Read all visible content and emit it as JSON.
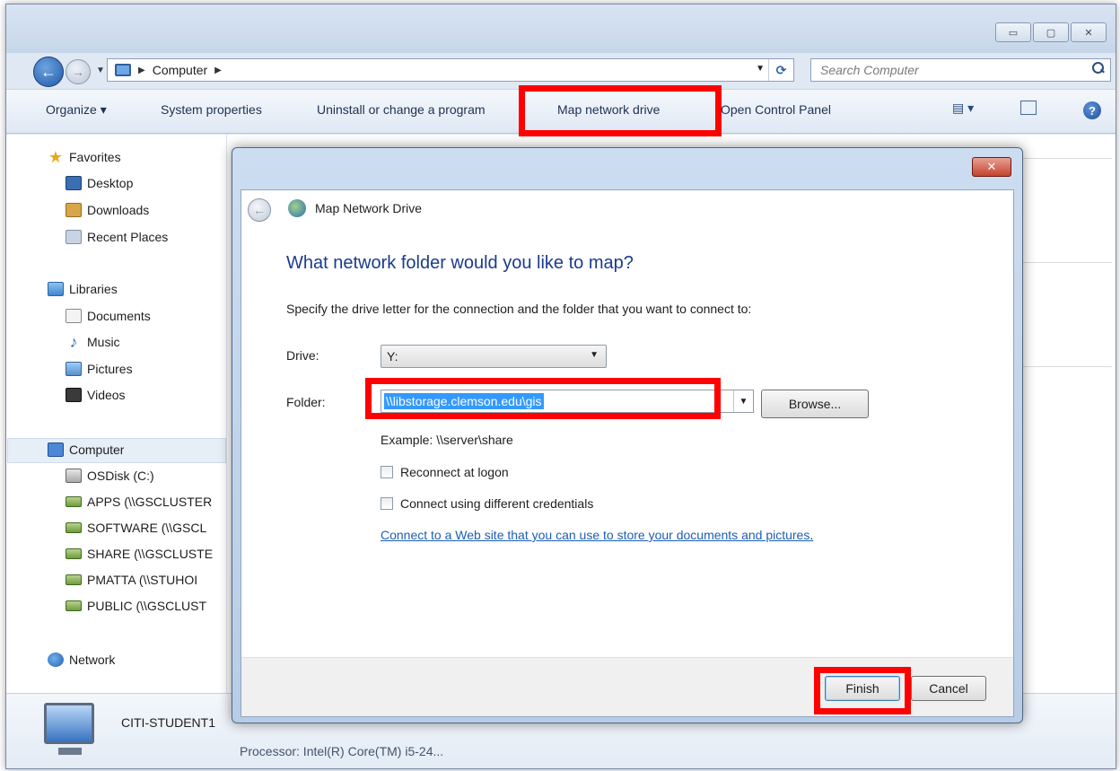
{
  "window": {
    "controls": {
      "minimize": "▭",
      "maximize": "▢",
      "close": "✕"
    },
    "address": {
      "location": "Computer",
      "chevron": "▶"
    },
    "search": {
      "placeholder": "Search Computer"
    },
    "toolbar": {
      "organize": "Organize ▾",
      "system_properties": "System properties",
      "uninstall": "Uninstall or change a program",
      "map_network_drive": "Map network drive",
      "open_control_panel": "Open Control Panel",
      "views_glyph": "▤ ▾",
      "help_glyph": "?"
    }
  },
  "navpane": {
    "favorites": {
      "title": "Favorites",
      "items": [
        "Desktop",
        "Downloads",
        "Recent Places"
      ]
    },
    "libraries": {
      "title": "Libraries",
      "items": [
        "Documents",
        "Music",
        "Pictures",
        "Videos"
      ]
    },
    "computer": {
      "title": "Computer",
      "items": [
        "OSDisk (C:)",
        "APPS (\\\\GSCLUSTER",
        "SOFTWARE (\\\\GSCL",
        "SHARE (\\\\GSCLUSTE",
        "PMATTA (\\\\STUHOI",
        "PUBLIC (\\\\GSCLUST"
      ]
    },
    "network": {
      "title": "Network"
    }
  },
  "details": {
    "computer_name": "CITI-STUDENT1",
    "processor": "Processor: Intel(R) Core(TM) i5-24..."
  },
  "dialog": {
    "title": "Map Network Drive",
    "close_glyph": "✕",
    "question": "What network folder would you like to map?",
    "instruction": "Specify the drive letter for the connection and the folder that you want to connect to:",
    "drive_label": "Drive:",
    "drive_value": "Y:",
    "folder_label": "Folder:",
    "folder_value": "\\\\libstorage.clemson.edu\\gis",
    "browse_label": "Browse...",
    "example": "Example: \\\\server\\share",
    "reconnect_label": "Reconnect at logon",
    "reconnect_checked": false,
    "credentials_label": "Connect using different credentials",
    "credentials_checked": false,
    "web_link": "Connect to a Web site that you can use to store your documents and pictures",
    "web_link_suffix": ".",
    "finish_label": "Finish",
    "cancel_label": "Cancel"
  },
  "highlight_color": "#ff0000"
}
